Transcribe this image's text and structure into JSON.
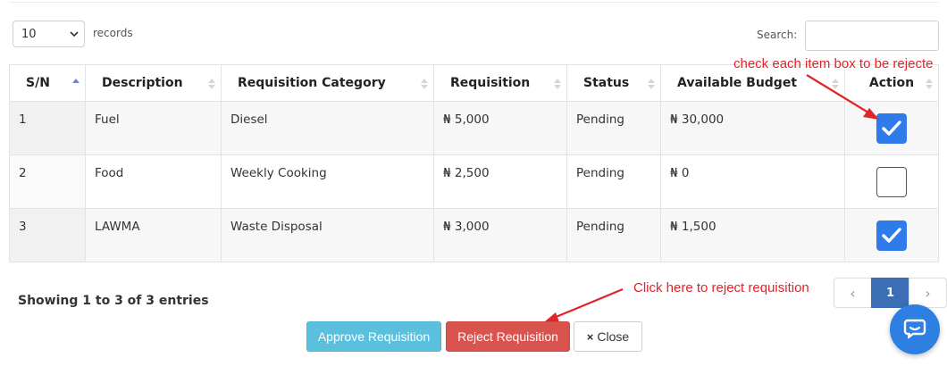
{
  "length_menu": {
    "value": "10",
    "label": "records"
  },
  "search": {
    "label": "Search:",
    "value": ""
  },
  "table": {
    "columns": [
      "S/N",
      "Description",
      "Requisition Category",
      "Requisition",
      "Status",
      "Available Budget",
      "Action"
    ],
    "rows": [
      {
        "sn": "1",
        "description": "Fuel",
        "category": "Diesel",
        "requisition": "₦ 5,000",
        "status": "Pending",
        "budget": "₦ 30,000",
        "checked": true
      },
      {
        "sn": "2",
        "description": "Food",
        "category": "Weekly Cooking",
        "requisition": "₦ 2,500",
        "status": "Pending",
        "budget": "₦ 0",
        "checked": false
      },
      {
        "sn": "3",
        "description": "LAWMA",
        "category": "Waste Disposal",
        "requisition": "₦ 3,000",
        "status": "Pending",
        "budget": "₦ 1,500",
        "checked": true
      }
    ]
  },
  "info": "Showing 1 to 3 of 3 entries",
  "pagination": {
    "prev": "‹",
    "current": "1",
    "next": "›"
  },
  "buttons": {
    "approve": "Approve Requisition",
    "reject": "Reject Requisition",
    "close": "Close",
    "close_icon": "×"
  },
  "annotations": {
    "check_hint": "check each item box to be rejecte",
    "reject_hint": "Click here to reject requisition"
  },
  "colors": {
    "pending": "#eba85a",
    "checkbox_checked": "#2f7bea",
    "approve": "#5bc0de",
    "reject": "#d9534f",
    "annotation": "#e0242a",
    "page_active": "#3c6eb5",
    "chat_bubble": "#2d7fe2"
  },
  "icons": [
    "chevron-down-icon",
    "sort-icon",
    "sort-asc-icon",
    "checkmark-icon",
    "close-x-icon",
    "chat-icon",
    "arrow-icon"
  ]
}
